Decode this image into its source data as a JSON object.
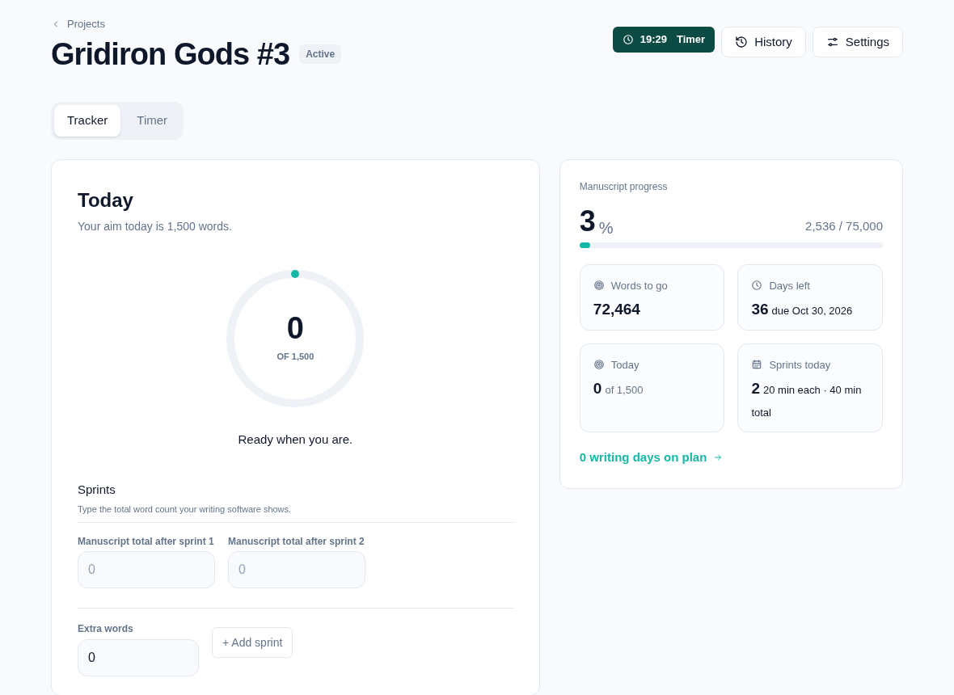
{
  "breadcrumb": "Projects",
  "title": "Gridiron Gods #3",
  "status_badge": "Active",
  "header_buttons": [
    {
      "kind": "timer",
      "time": "19:29",
      "label": "Timer"
    },
    {
      "kind": "history",
      "label": "History"
    },
    {
      "kind": "settings",
      "label": "Settings"
    }
  ],
  "tabs": [
    {
      "label": "Tracker",
      "selected": true
    },
    {
      "label": "Timer",
      "selected": false
    }
  ],
  "today": {
    "heading": "Today",
    "subtitle": "Your aim today is 1,500 words.",
    "ring": {
      "value": "0",
      "caption": "OF 1,500"
    },
    "message": "Ready when you are."
  },
  "sprints": {
    "heading": "Sprints",
    "hint": "Type the total word count your writing software shows.",
    "fields": [
      {
        "label": "Manuscript total after sprint 1",
        "placeholder": "0"
      },
      {
        "label": "Manuscript total after sprint 2",
        "placeholder": "0"
      }
    ],
    "extra": {
      "label": "Extra words",
      "value": "0"
    },
    "add_button": "+ Add sprint"
  },
  "progress": {
    "label": "Manuscript progress",
    "percent": "3",
    "unit": "%",
    "count": "2,536 / 75,000",
    "level": 0.034,
    "stats": [
      {
        "label": "Words to go",
        "value": "72,464"
      },
      {
        "label": "Days left",
        "value": "36",
        "detail": "due Oct 30, 2026"
      },
      {
        "label": "Today",
        "value": "0",
        "detail": "of 1,500"
      },
      {
        "label": "Sprints today",
        "value": "2",
        "detail": "20 min each · 40 min total"
      }
    ],
    "link": "0 writing days on plan"
  }
}
